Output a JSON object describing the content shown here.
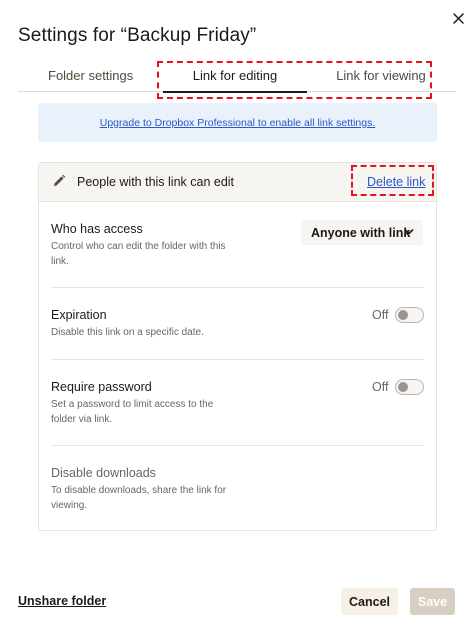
{
  "dialog": {
    "title": "Settings for “Backup Friday”",
    "close_icon": "close-icon"
  },
  "tabs": [
    {
      "label": "Folder settings",
      "active": false
    },
    {
      "label": "Link for editing",
      "active": true
    },
    {
      "label": "Link for viewing",
      "active": false
    }
  ],
  "upgrade_banner": {
    "link_text": "Upgrade to Dropbox Professional to enable all link settings."
  },
  "link_card": {
    "header": {
      "icon": "pencil-icon",
      "text": "People with this link can edit",
      "delete_label": "Delete link"
    },
    "access": {
      "title": "Who has access",
      "description": "Control who can edit the folder with this link.",
      "selected": "Anyone with link",
      "icon": "chevron-down-icon"
    },
    "expiration": {
      "title": "Expiration",
      "description": "Disable this link on a specific date.",
      "toggle_label": "Off"
    },
    "password": {
      "title": "Require password",
      "description": "Set a password to limit access to the folder via link.",
      "toggle_label": "Off"
    },
    "downloads": {
      "title": "Disable downloads",
      "description": "To disable downloads, share the link for viewing."
    }
  },
  "footer": {
    "unshare_label": "Unshare folder",
    "cancel_label": "Cancel",
    "save_label": "Save"
  },
  "colors": {
    "highlight": "#e0151f",
    "link": "#2a58c9",
    "banner_bg": "#e9f1fb",
    "save_disabled": "#d9cec2"
  }
}
